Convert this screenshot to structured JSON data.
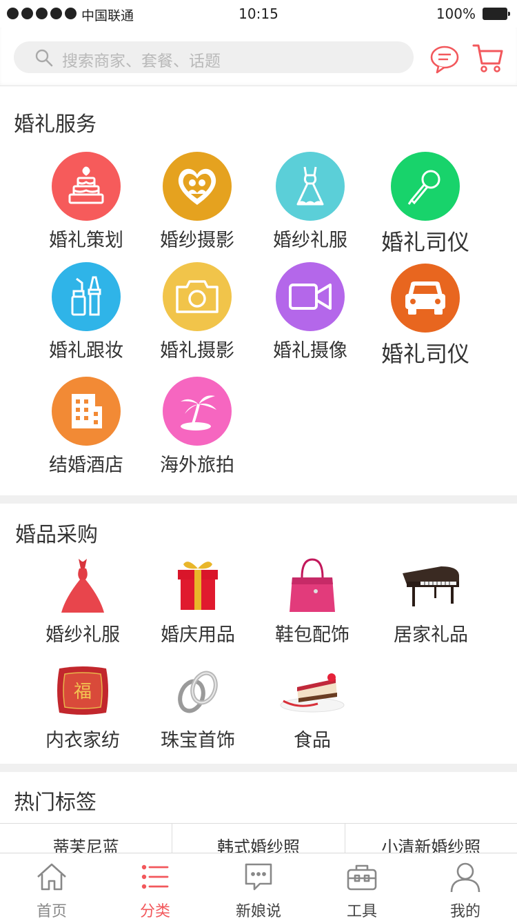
{
  "status": {
    "carrier": "中国联通",
    "time": "10:15",
    "battery": "100%"
  },
  "search": {
    "placeholder": "搜索商家、套餐、话题"
  },
  "colors": {
    "accent": "#f2585c"
  },
  "wedding_services": {
    "title": "婚礼服务",
    "items": [
      {
        "label": "婚礼策划",
        "icon": "cake-icon",
        "color": "#f65b5b"
      },
      {
        "label": "婚纱摄影",
        "icon": "couple-heart-icon",
        "color": "#e5a21f"
      },
      {
        "label": "婚纱礼服",
        "icon": "dress-icon",
        "color": "#5bcfd8"
      },
      {
        "label": "婚礼司仪",
        "icon": "microphone-icon",
        "color": "#18d36b"
      },
      {
        "label": "婚礼跟妆",
        "icon": "makeup-icon",
        "color": "#2fb4e8"
      },
      {
        "label": "婚礼摄影",
        "icon": "camera-icon",
        "color": "#f1c44a"
      },
      {
        "label": "婚礼摄像",
        "icon": "video-camera-icon",
        "color": "#b467ea"
      },
      {
        "label": "婚礼司仪",
        "icon": "car-icon",
        "color": "#e8661f"
      },
      {
        "label": "结婚酒店",
        "icon": "hotel-icon",
        "color": "#f28a35"
      },
      {
        "label": "海外旅拍",
        "icon": "palm-island-icon",
        "color": "#f666c0"
      }
    ]
  },
  "wedding_goods": {
    "title": "婚品采购",
    "items": [
      {
        "label": "婚纱礼服",
        "icon": "red-gown-icon"
      },
      {
        "label": "婚庆用品",
        "icon": "gift-box-icon"
      },
      {
        "label": "鞋包配饰",
        "icon": "handbag-icon"
      },
      {
        "label": "居家礼品",
        "icon": "piano-icon"
      },
      {
        "label": "内衣家纺",
        "icon": "pillow-icon"
      },
      {
        "label": "珠宝首饰",
        "icon": "rings-icon"
      },
      {
        "label": "食品",
        "icon": "cake-slice-icon"
      }
    ],
    "pillow_text": "福"
  },
  "hot_tags": {
    "title": "热门标签",
    "items": [
      "蒂芙尼蓝",
      "韩式婚纱照",
      "小清新婚纱照"
    ]
  },
  "tabbar": {
    "items": [
      {
        "label": "首页",
        "icon": "home-icon"
      },
      {
        "label": "分类",
        "icon": "list-icon"
      },
      {
        "label": "新娘说",
        "icon": "chat-icon"
      },
      {
        "label": "工具",
        "icon": "toolbox-icon"
      },
      {
        "label": "我的",
        "icon": "user-icon"
      }
    ],
    "active_index": 1
  }
}
